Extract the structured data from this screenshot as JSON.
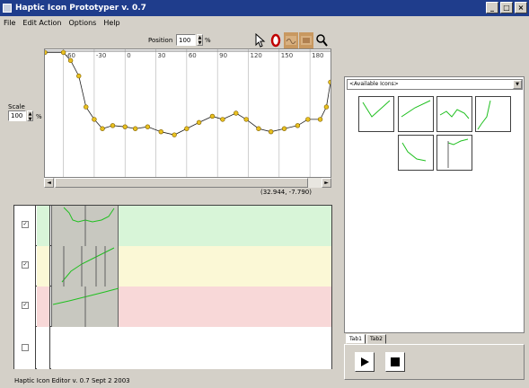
{
  "window": {
    "title": "Haptic Icon Prototyper v. 0.7"
  },
  "menu": [
    "File",
    "Edit Action",
    "Options",
    "Help"
  ],
  "toolbar": {
    "position_label": "Position",
    "position_value": "100",
    "position_unit": "%"
  },
  "editor": {
    "axis_ticks": [
      "-60",
      "-30",
      "0",
      "30",
      "60",
      "90",
      "120",
      "150",
      "180"
    ],
    "scale_label": "Scale",
    "scale_value": "100",
    "scale_unit": "%",
    "coordinates": "(32.944, -7.790)"
  },
  "waveform": {
    "points": [
      [
        -78,
        0.98
      ],
      [
        -60,
        0.98
      ],
      [
        -53,
        0.85
      ],
      [
        -45,
        0.6
      ],
      [
        -38,
        0.1
      ],
      [
        -30,
        -0.1
      ],
      [
        -22,
        -0.25
      ],
      [
        -12,
        -0.2
      ],
      [
        0,
        -0.22
      ],
      [
        10,
        -0.25
      ],
      [
        22,
        -0.22
      ],
      [
        35,
        -0.3
      ],
      [
        48,
        -0.35
      ],
      [
        60,
        -0.25
      ],
      [
        72,
        -0.15
      ],
      [
        85,
        -0.05
      ],
      [
        95,
        -0.1
      ],
      [
        108,
        0.0
      ],
      [
        118,
        -0.1
      ],
      [
        130,
        -0.25
      ],
      [
        142,
        -0.3
      ],
      [
        155,
        -0.25
      ],
      [
        168,
        -0.2
      ],
      [
        178,
        -0.1
      ],
      [
        190,
        -0.1
      ],
      [
        196,
        0.1
      ],
      [
        200,
        0.5
      ]
    ]
  },
  "tracks": [
    {
      "checked": true,
      "color": "#d8f5d8"
    },
    {
      "checked": true,
      "color": "#fbf8d6"
    },
    {
      "checked": true,
      "color": "#f8d8d8"
    },
    {
      "checked": false,
      "color": "#ffffff"
    }
  ],
  "library": {
    "dropdown_value": "<Available Icons>",
    "icons": [
      "icon-1",
      "icon-2",
      "icon-3",
      "icon-4",
      "icon-5",
      "icon-6"
    ]
  },
  "tabs": [
    "Tab1",
    "Tab2"
  ],
  "status": "Haptic Icon Editor v. 0.7 Sept 2 2003"
}
